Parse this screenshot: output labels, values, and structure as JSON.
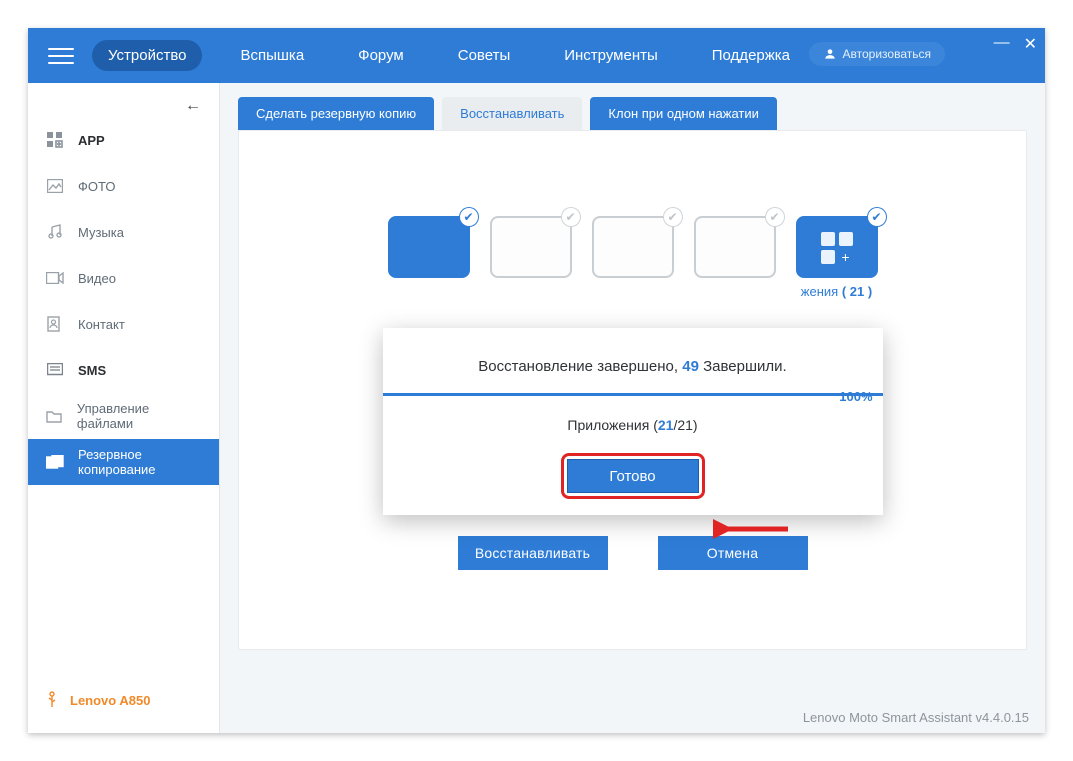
{
  "nav": {
    "tabs": [
      "Устройство",
      "Вспышка",
      "Форум",
      "Советы",
      "Инструменты",
      "Поддержка"
    ],
    "active": 0,
    "auth_label": "Авторизоваться"
  },
  "sidebar": {
    "items": [
      {
        "label": "APP",
        "bold": true
      },
      {
        "label": "ФОТО"
      },
      {
        "label": "Музыка"
      },
      {
        "label": "Видео"
      },
      {
        "label": "Контакт"
      },
      {
        "label": "SMS",
        "bold": true
      },
      {
        "label": "Управление файлами"
      },
      {
        "label": "Резервное копирование",
        "active": true
      }
    ],
    "device_label": "Lenovo A850"
  },
  "subtabs": {
    "items": [
      "Сделать резервную копию",
      "Восстанавливать",
      "Клон при одном нажатии"
    ],
    "current": 1
  },
  "panel": {
    "app_tile_caption_prefix": "жения",
    "app_tile_count": "( 21 )",
    "restore_button": "Восстанавливать",
    "cancel_button": "Отмена"
  },
  "modal": {
    "line_prefix": "Восстановление завершено,",
    "completed_count": "49",
    "line_suffix": "Завершили.",
    "percent": "100%",
    "sub_prefix": "Приложения (",
    "sub_current": "21",
    "sub_sep": "/",
    "sub_total": "21",
    "sub_suffix": ")",
    "done_label": "Готово"
  },
  "footer": "Lenovo Moto Smart Assistant v4.4.0.15"
}
